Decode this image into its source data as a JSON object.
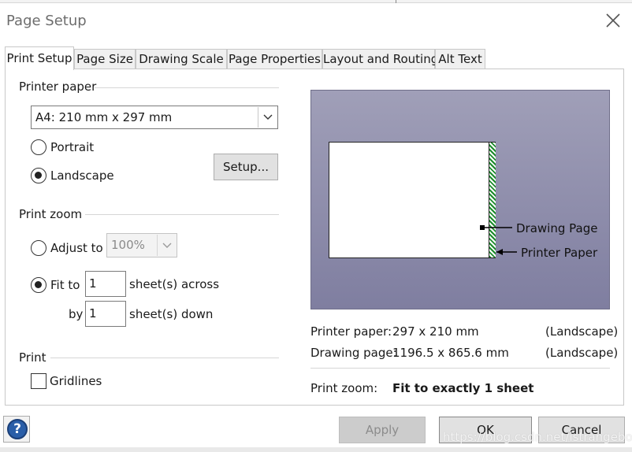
{
  "window": {
    "title": "Page Setup"
  },
  "tabs": [
    {
      "label": "Print Setup",
      "active": true
    },
    {
      "label": "Page Size",
      "active": false
    },
    {
      "label": "Drawing Scale",
      "active": false
    },
    {
      "label": "Page Properties",
      "active": false
    },
    {
      "label": "Layout and Routing",
      "active": false
    },
    {
      "label": "Alt Text",
      "active": false
    }
  ],
  "printer_paper": {
    "group_label": "Printer paper",
    "paper_select": "A4:  210 mm x 297 mm",
    "portrait_label": "Portrait",
    "landscape_label": "Landscape",
    "orientation": "Landscape",
    "setup_button": "Setup..."
  },
  "print_zoom": {
    "group_label": "Print zoom",
    "adjust_label": "Adjust to",
    "adjust_value": "100%",
    "fit_label": "Fit to",
    "across_value": "1",
    "across_label": "sheet(s) across",
    "by_label": "by",
    "down_value": "1",
    "down_label": "sheet(s) down",
    "mode": "Fit to"
  },
  "print": {
    "group_label": "Print",
    "gridlines_label": "Gridlines",
    "gridlines_checked": false
  },
  "preview": {
    "drawing_page_label": "Drawing Page",
    "printer_paper_label": "Printer Paper"
  },
  "info": {
    "printer_paper_key": "Printer paper:",
    "printer_paper_value": "297 x 210 mm",
    "printer_paper_orient": "(Landscape)",
    "drawing_page_key": "Drawing page:",
    "drawing_page_value": "1196.5 x 865.6 mm",
    "drawing_page_orient": "(Landscape)",
    "print_zoom_key": "Print zoom:",
    "print_zoom_value": "Fit to exactly 1 sheet"
  },
  "footer": {
    "help_glyph": "?",
    "apply": "Apply",
    "ok": "OK",
    "cancel": "Cancel",
    "watermark": "https://blog.csdn.net/istrangeboy"
  },
  "icons": {
    "close": "close-icon",
    "help": "help-icon",
    "dropdown": "chevron-down-icon"
  },
  "colors": {
    "preview_bg": "#8e8dab",
    "hatch_green": "#1a8a2a",
    "help_blue": "#2a5ea8"
  }
}
